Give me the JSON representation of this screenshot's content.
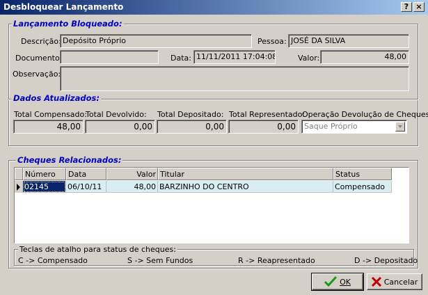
{
  "window": {
    "title": "Desbloquear Lançamento",
    "help_label": "?",
    "close_label": "×"
  },
  "locked_entry": {
    "section_title": "Lançamento Bloqueado:",
    "descricao_label": "Descrição:",
    "descricao_value": "Depósito Próprio",
    "pessoa_label": "Pessoa:",
    "pessoa_value": "JOSÉ DA SILVA",
    "documento_label": "Documento:",
    "documento_value": "",
    "data_label": "Data:",
    "data_value": "11/11/2011 17:04:08",
    "valor_label": "Valor:",
    "valor_value": "48,00",
    "observacao_label": "Observação:",
    "observacao_value": ""
  },
  "updated": {
    "section_title": "Dados Atualizados:",
    "total_compensado_label": "Total Compensado:",
    "total_compensado_value": "48,00",
    "total_devolvido_label": "Total Devolvido:",
    "total_devolvido_value": "0,00",
    "total_depositado_label": "Total Depositado:",
    "total_depositado_value": "0,00",
    "total_representado_label": "Total Representado:",
    "total_representado_value": "0,00",
    "operacao_label": "Operação Devolução de Cheques:",
    "operacao_value": "Saque Próprio"
  },
  "cheques": {
    "section_title": "Cheques Relacionados:",
    "columns": [
      "Número",
      "Data",
      "Valor",
      "Titular",
      "Status"
    ],
    "rows": [
      {
        "numero": "02145",
        "data": "06/10/11",
        "valor": "48,00",
        "titular": "BARZINHO DO CENTRO",
        "status": "Compensado"
      }
    ]
  },
  "shortcuts": {
    "title": "Teclas de atalho para status de cheques:",
    "items": [
      "C -> Compensado",
      "S -> Sem Fundos",
      "R -> Reapresentado",
      "D -> Depositado"
    ]
  },
  "buttons": {
    "ok_label": "OK",
    "cancel_label": "Cancelar"
  },
  "colors": {
    "title_bar": "#0a246a",
    "section_title": "#0000c0",
    "row_highlight": "#d8eef2",
    "ok_check": "#1a9a1a",
    "cancel_x": "#c00000"
  }
}
